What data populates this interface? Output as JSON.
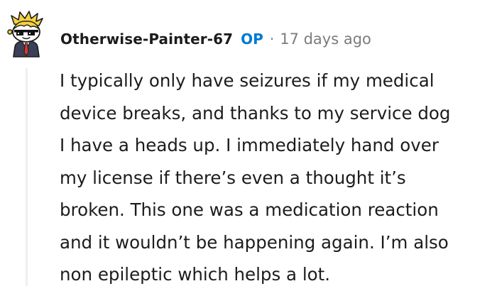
{
  "comment": {
    "author": "Otherwise-Painter-67",
    "badge": "OP",
    "separator": "·",
    "timestamp": "17 days ago",
    "avatar_icon": "snoo-avatar-icon",
    "body_lines": [
      "I typically only have seizures if my medical",
      "device breaks, and thanks to my service dog",
      "I have a heads up. I immediately hand over",
      "my license if there’s even a thought it’s",
      "broken. This one was a medication reaction",
      "and it wouldn’t be happening again. I’m also",
      "non epileptic which helps a lot."
    ]
  },
  "colors": {
    "op_badge": "#0079d3",
    "meta_text": "#7c7c7c",
    "thread_line": "#edeff1",
    "body_text": "#1c1c1c"
  }
}
